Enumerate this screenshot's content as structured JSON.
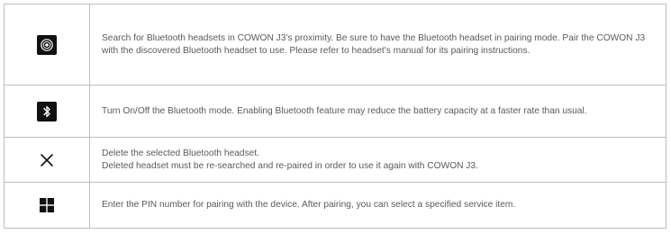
{
  "rows": [
    {
      "icon": "search-target-icon",
      "lines": [
        "Search for Bluetooth headsets in COWON J3's proximity. Be sure to have the Bluetooth headset in pairing mode. Pair the COWON J3 with the discovered Bluetooth headset to use. Please refer to headset's manual for its pairing instructions."
      ]
    },
    {
      "icon": "bluetooth-icon",
      "lines": [
        "Turn On/Off the Bluetooth mode. Enabling Bluetooth feature may reduce the battery capacity at a faster rate than usual."
      ]
    },
    {
      "icon": "close-icon",
      "lines": [
        "Delete the selected Bluetooth headset.",
        "Deleted headset must be re-searched and re-paired in order to use it again with COWON J3."
      ]
    },
    {
      "icon": "grid-icon",
      "lines": [
        "Enter the PIN number for pairing with the device. After pairing, you can select a specified service item."
      ]
    }
  ]
}
